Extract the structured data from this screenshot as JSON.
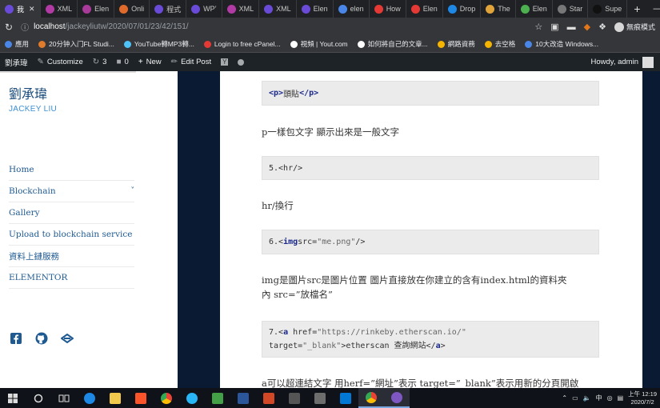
{
  "browser": {
    "tabs": [
      {
        "label": "我",
        "color": "#6a4bd8",
        "active": true
      },
      {
        "label": "XML",
        "color": "#b13aa4"
      },
      {
        "label": "Elen",
        "color": "#a83a9a"
      },
      {
        "label": "Onli",
        "color": "#e06a2b"
      },
      {
        "label": "程式",
        "color": "#6a4bd8"
      },
      {
        "label": "WP’",
        "color": "#6a4bd8"
      },
      {
        "label": "XML",
        "color": "#b13aa4"
      },
      {
        "label": "XML",
        "color": "#6a4bd8"
      },
      {
        "label": "Elen",
        "color": "#6a4bd8"
      },
      {
        "label": "elen",
        "color": "#4a86e8"
      },
      {
        "label": "How",
        "color": "#e53935"
      },
      {
        "label": "Elen",
        "color": "#e53935"
      },
      {
        "label": "Drop",
        "color": "#1e88e5"
      },
      {
        "label": "The",
        "color": "#e0a43a"
      },
      {
        "label": "Elen",
        "color": "#4caf50"
      },
      {
        "label": "Star",
        "color": "#777777"
      },
      {
        "label": "Supe",
        "color": "#111111"
      }
    ],
    "new_tab": "+",
    "window_controls": "—",
    "url_host": "localhost",
    "url_path": "/jackeyliutw/2020/07/01/23/42/151/",
    "profile_label": "無痕模式",
    "bookmarks": [
      {
        "label": "應用",
        "color": "#4a86e8"
      },
      {
        "label": "20分钟入门FL Studi...",
        "color": "#e07b2b"
      },
      {
        "label": "YouTube轉MP3轉...",
        "color": "#4fc3f7"
      },
      {
        "label": "Login to free cPanel...",
        "color": "#e53935"
      },
      {
        "label": "視頻 | Yout.com",
        "color": "#ffffff"
      },
      {
        "label": "如何將自己的文章...",
        "color": "#ffffff"
      },
      {
        "label": "網路資務",
        "color": "#f4b400"
      },
      {
        "label": "去空格",
        "color": "#f4b400"
      },
      {
        "label": "10大改造 Windows...",
        "color": "#4a86e8"
      }
    ]
  },
  "wp_admin_bar": {
    "site_name": "劉承瑋",
    "customize": "Customize",
    "updates_count": "3",
    "comments_count": "0",
    "new_label": "New",
    "edit_post": "Edit Post",
    "howdy": "Howdy, admin"
  },
  "site": {
    "title": "劉承瑋",
    "subtitle": "JACKEY LIU",
    "menu": [
      {
        "label": "Home",
        "has_children": false
      },
      {
        "label": "Blockchain",
        "has_children": true
      },
      {
        "label": "Gallery",
        "has_children": false
      },
      {
        "label": "Upload to blockchain service",
        "has_children": false
      },
      {
        "label": "資料上鏈服務",
        "has_children": false
      },
      {
        "label": "ELEMENTOR",
        "has_children": false
      }
    ],
    "social_icons": [
      "facebook-icon",
      "github-icon",
      "ethereum-icon"
    ]
  },
  "post": {
    "code1": {
      "tag_open": "<p>",
      "text": "頭貼",
      "tag_close": "</p>"
    },
    "para1": "p一樣包文字 顯示出來是一般文字",
    "code2": "5.<hr/>",
    "para2": "hr/換行",
    "code3": {
      "prefix": "6.<",
      "tag": "img",
      "attr": " src=",
      "value": "\"me.png\"",
      "suffix": " />"
    },
    "para3_line1": " img是圖片src是圖片位置 圖片直接放在你建立的含有index.html的資料夾",
    "para3_line2": "內 src=”放檔名”",
    "code4": {
      "prefix": "7.<",
      "tag": "a",
      "attr1": " href=",
      "value1": "\"https://rinkeby.etherscan.io/\"",
      "attr2": "target=",
      "value2": "\"_blank\"",
      "text": ">etherscan 查詢網站</",
      "tag_close": "a",
      "end": ">"
    },
    "para4": "a可以超連結文字 用herf=”網址”表示 target=”_blank”表示用新的分頁開啟"
  },
  "taskbar": {
    "clock_time": "上午 12:19",
    "clock_date": "2020/7/2",
    "ime": "中"
  }
}
